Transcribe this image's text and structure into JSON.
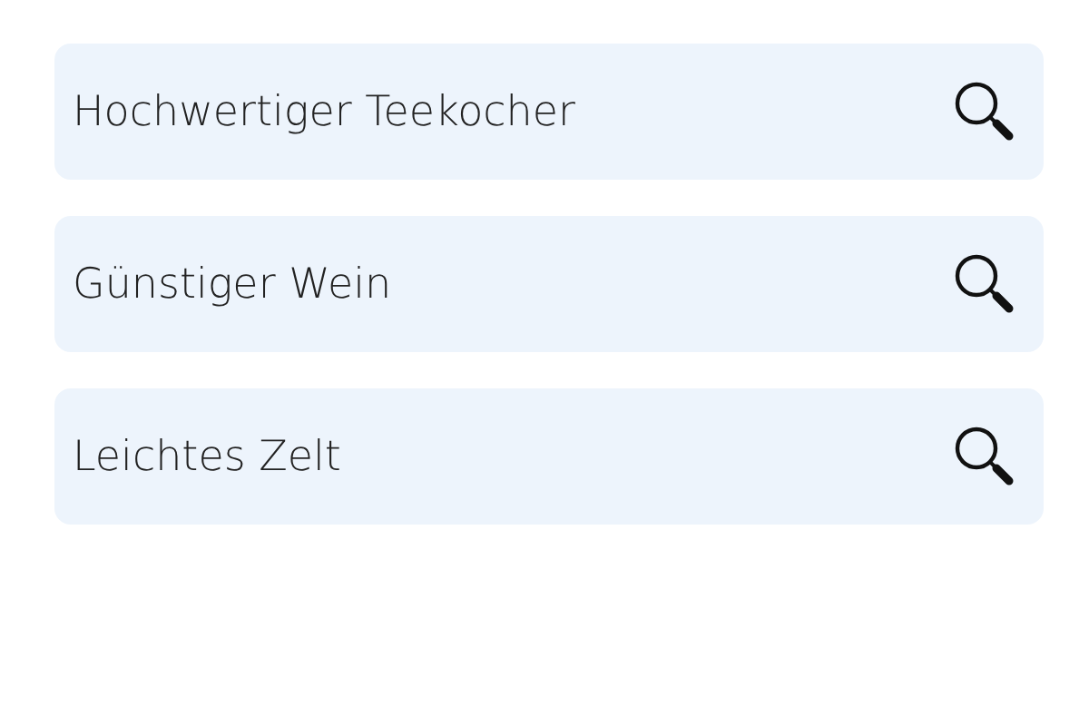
{
  "search_fields": [
    {
      "value": "Hochwertiger Teekocher"
    },
    {
      "value": "Günstiger Wein"
    },
    {
      "value": "Leichtes Zelt"
    }
  ]
}
